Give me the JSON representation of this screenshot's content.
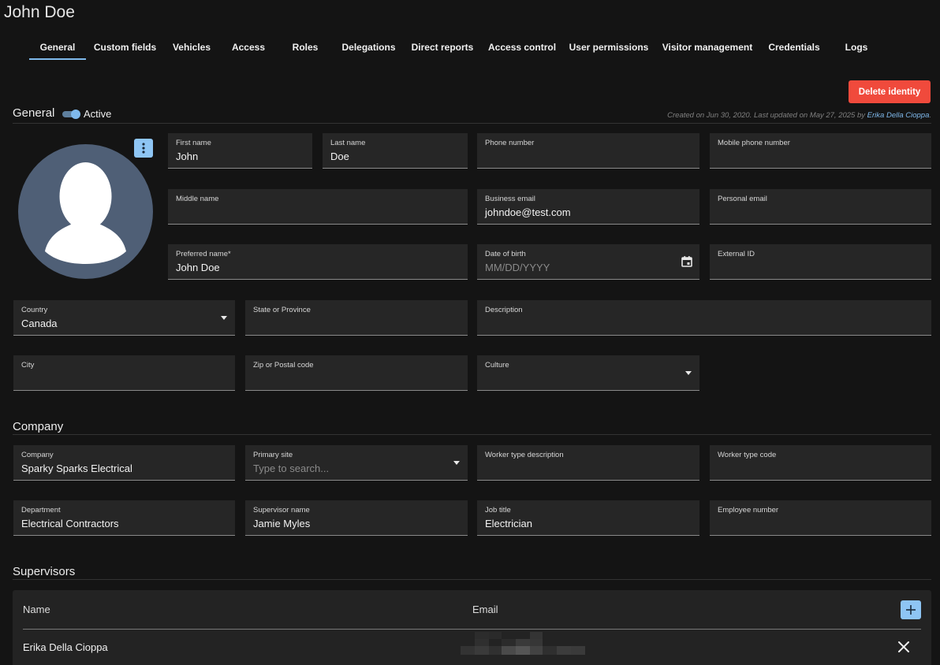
{
  "page": {
    "title": "John Doe"
  },
  "tabs": [
    {
      "label": "General",
      "active": true
    },
    {
      "label": "Custom fields"
    },
    {
      "label": "Vehicles"
    },
    {
      "label": "Access"
    },
    {
      "label": "Roles"
    },
    {
      "label": "Delegations"
    },
    {
      "label": "Direct reports"
    },
    {
      "label": "Access control"
    },
    {
      "label": "User permissions"
    },
    {
      "label": "Visitor management"
    },
    {
      "label": "Credentials"
    },
    {
      "label": "Logs"
    }
  ],
  "actions": {
    "delete_label": "Delete identity"
  },
  "general": {
    "title": "General",
    "active_label": "Active",
    "active": true,
    "meta_prefix": "Created on Jun 30, 2020. Last updated on May 27, 2025 by ",
    "meta_user": "Erika Della Cioppa",
    "meta_suffix": ".",
    "avatar_menu_icon": "vertical-dots-icon",
    "fields": {
      "first_name": {
        "label": "First name",
        "value": "John"
      },
      "last_name": {
        "label": "Last name",
        "value": "Doe"
      },
      "phone": {
        "label": "Phone number",
        "value": ""
      },
      "mobile": {
        "label": "Mobile phone number",
        "value": ""
      },
      "middle_name": {
        "label": "Middle name",
        "value": ""
      },
      "business_email": {
        "label": "Business email",
        "value": "johndoe@test.com"
      },
      "personal_email": {
        "label": "Personal email",
        "value": ""
      },
      "preferred_name": {
        "label": "Preferred name",
        "required": "*",
        "value": "John Doe"
      },
      "dob": {
        "label": "Date of birth",
        "placeholder": "MM/DD/YYYY"
      },
      "external_id": {
        "label": "External ID",
        "value": ""
      },
      "country": {
        "label": "Country",
        "value": "Canada"
      },
      "state": {
        "label": "State or Province",
        "value": ""
      },
      "description": {
        "label": "Description",
        "value": ""
      },
      "city": {
        "label": "City",
        "value": ""
      },
      "zip": {
        "label": "Zip or Postal code",
        "value": ""
      },
      "culture": {
        "label": "Culture",
        "value": ""
      }
    }
  },
  "company": {
    "title": "Company",
    "fields": {
      "company": {
        "label": "Company",
        "value": "Sparky Sparks Electrical"
      },
      "primary_site": {
        "label": "Primary site",
        "placeholder": "Type to search..."
      },
      "worker_type_description": {
        "label": "Worker type description",
        "value": ""
      },
      "worker_type_code": {
        "label": "Worker type code",
        "value": ""
      },
      "department": {
        "label": "Department",
        "value": "Electrical Contractors"
      },
      "supervisor_name": {
        "label": "Supervisor name",
        "value": "Jamie Myles"
      },
      "job_title": {
        "label": "Job title",
        "value": "Electrician"
      },
      "employee_number": {
        "label": "Employee number",
        "value": ""
      }
    }
  },
  "supervisors": {
    "title": "Supervisors",
    "columns": {
      "name": "Name",
      "email": "Email"
    },
    "add_icon": "plus-icon",
    "rows": [
      {
        "name": "Erika Della Cioppa",
        "email_redacted": true
      }
    ]
  },
  "colors": {
    "accent": "#7fb9ec",
    "danger": "#f04a3c",
    "background": "#141414",
    "field_bg": "#262626"
  }
}
